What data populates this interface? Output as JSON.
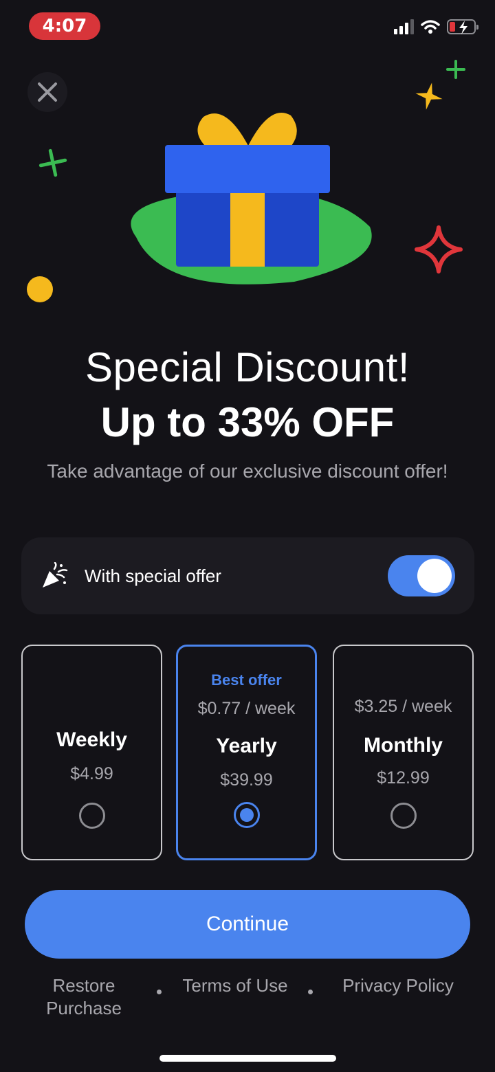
{
  "status_bar": {
    "time": "4:07"
  },
  "hero": {
    "title": "Special Discount!",
    "headline": "Up to 33% OFF",
    "subtitle": "Take advantage of our exclusive discount offer!"
  },
  "special_offer": {
    "label": "With special offer",
    "enabled": true
  },
  "plans": [
    {
      "name": "Weekly",
      "price": "$4.99",
      "selected": false
    },
    {
      "badge": "Best offer",
      "per_week": "$0.77 / week",
      "name": "Yearly",
      "price": "$39.99",
      "selected": true
    },
    {
      "per_week": "$3.25 / week",
      "name": "Monthly",
      "price": "$12.99",
      "selected": false
    }
  ],
  "continue_label": "Continue",
  "footer": {
    "restore_line1": "Restore",
    "restore_line2": "Purchase",
    "terms": "Terms of Use",
    "privacy": "Privacy Policy"
  },
  "colors": {
    "accent": "#4a84ee",
    "background": "#131217",
    "card": "#1c1b21",
    "gift_box": "#1e46c8",
    "gift_ribbon": "#f5b91d",
    "grass": "#3bbb52",
    "star_red": "#e0363b"
  },
  "icons": [
    "close-icon",
    "party-popper-icon",
    "gift-icon",
    "sparkle-icon"
  ]
}
